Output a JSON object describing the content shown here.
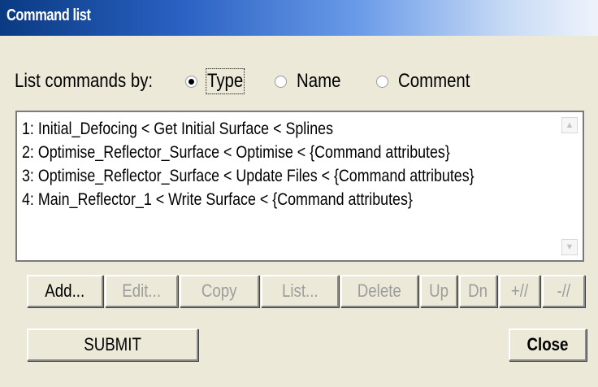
{
  "window": {
    "title": "Command list"
  },
  "list_by": {
    "label": "List commands by:",
    "options": [
      {
        "label": "Type",
        "checked": true
      },
      {
        "label": "Name",
        "checked": false
      },
      {
        "label": "Comment",
        "checked": false
      }
    ]
  },
  "commands": [
    "1:  Initial_Defocing < Get Initial Surface < Splines",
    "2:  Optimise_Reflector_Surface < Optimise < {Command attributes}",
    "3:  Optimise_Reflector_Surface < Update Files < {Command attributes}",
    "4:  Main_Reflector_1 < Write Surface < {Command attributes}"
  ],
  "toolbar": {
    "add": "Add...",
    "edit": "Edit...",
    "copy": "Copy",
    "list": "List...",
    "delete": "Delete",
    "up": "Up",
    "dn": "Dn",
    "plus": "+//",
    "minus": "-//"
  },
  "footer": {
    "submit": "SUBMIT",
    "close": "Close"
  },
  "colors": {
    "dialog_bg": "#ece9d8",
    "title_bar": "#0a3a82",
    "disabled_text": "#9d9d9d"
  },
  "icons": {
    "scroll_up": "scroll-up-arrow-icon",
    "scroll_down": "scroll-down-arrow-icon"
  }
}
